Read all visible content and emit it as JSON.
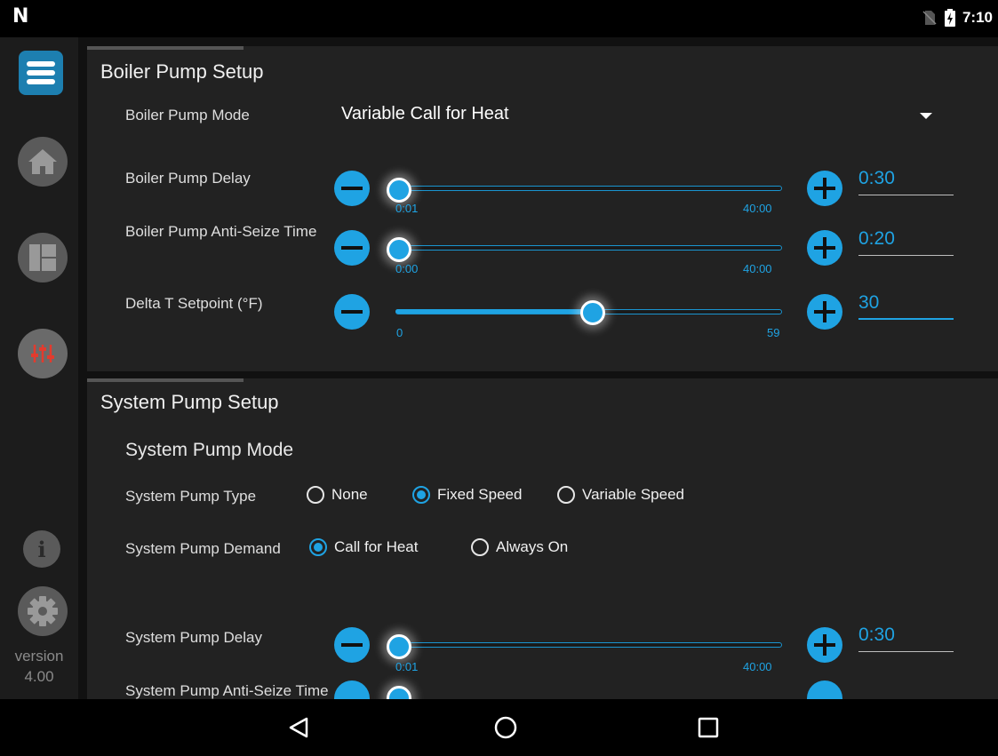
{
  "statusbar": {
    "time": "7:10"
  },
  "sidebar": {
    "version_label": "version",
    "version_number": "4.00"
  },
  "boiler": {
    "title": "Boiler Pump Setup",
    "mode_label": "Boiler Pump Mode",
    "mode_value": "Variable Call for Heat",
    "delay": {
      "label": "Boiler Pump Delay",
      "min": "0:01",
      "max": "40:00",
      "value": "0:30",
      "position": 0.0
    },
    "antiseize": {
      "label": "Boiler Pump Anti-Seize Time",
      "min": "0:00",
      "max": "40:00",
      "value": "0:20",
      "position": 0.0
    },
    "deltat": {
      "label": "Delta T Setpoint (°F)",
      "min": "0",
      "max": "59",
      "value": "30",
      "position": 0.508
    }
  },
  "system": {
    "title": "System Pump Setup",
    "mode_heading": "System Pump Mode",
    "type_label": "System Pump Type",
    "type_options": [
      "None",
      "Fixed Speed",
      "Variable Speed"
    ],
    "type_selected": "Fixed Speed",
    "demand_label": "System Pump Demand",
    "demand_options": [
      "Call for Heat",
      "Always On"
    ],
    "demand_selected": "Call for Heat",
    "delay": {
      "label": "System Pump Delay",
      "min": "0:01",
      "max": "40:00",
      "value": "0:30",
      "position": 0.0
    },
    "antiseize_label": "System Pump Anti-Seize Time"
  }
}
